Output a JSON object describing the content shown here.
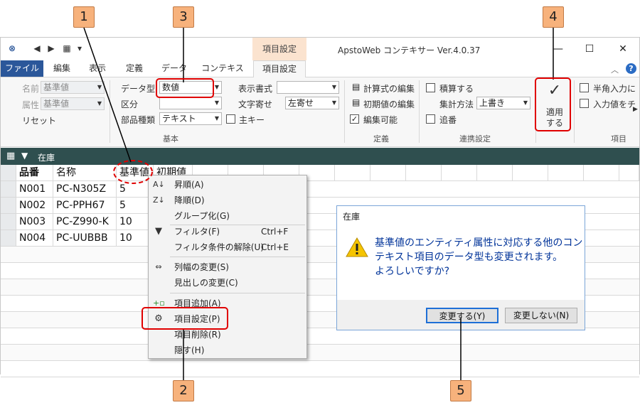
{
  "window": {
    "app_title": "ApstoWeb コンテキサー Ver.4.0.37",
    "context_tab_title": "項目設定",
    "tabs": [
      "ファイル",
      "編集",
      "表示",
      "定義",
      "データ",
      "コンテキスト",
      "項目設定"
    ]
  },
  "ribbon": {
    "name_label": "名前",
    "name_value": "基準値",
    "attr_label": "属性",
    "attr_value": "基準値",
    "reset_label": "リセット",
    "datatype_label": "データ型",
    "datatype_value": "数値",
    "kubun_label": "区分",
    "kubun_value": "",
    "parts_label": "部品種類",
    "parts_value": "テキスト",
    "mainkey_label": "主キー",
    "display_format_label": "表示書式",
    "display_format_value": "",
    "align_label": "文字寄せ",
    "align_value": "左寄せ",
    "group_kihon": "基本",
    "calc_edit_label": "計算式の編集",
    "init_edit_label": "初期値の編集",
    "editable_label": "編集可能",
    "group_teigi": "定義",
    "accumulate_label": "積算する",
    "agg_method_label": "集計方法",
    "agg_method_value": "上書き",
    "append_label": "追番",
    "group_renkei": "連携設定",
    "apply_label_1": "適用",
    "apply_label_2": "する",
    "hankaku_label": "半角入力に",
    "input_check_label": "入力値をチ",
    "group_item": "項目"
  },
  "grid": {
    "caption": "在庫",
    "headers": [
      "品番",
      "名称",
      "基準値",
      "初期値"
    ],
    "rows": [
      [
        "N001",
        "PC-N305Z",
        "5"
      ],
      [
        "N002",
        "PC-PPH67",
        "5"
      ],
      [
        "N003",
        "PC-Z990-K",
        "10"
      ],
      [
        "N004",
        "PC-UUBBB",
        "10"
      ]
    ]
  },
  "context_menu": {
    "items": [
      {
        "label": "昇順(A)",
        "shortcut": ""
      },
      {
        "label": "降順(D)",
        "shortcut": ""
      },
      {
        "label": "グループ化(G)",
        "shortcut": ""
      },
      {
        "label": "フィルタ(F)",
        "shortcut": "Ctrl+F"
      },
      {
        "label": "フィルタ条件の解除(U)",
        "shortcut": "Ctrl+E"
      },
      {
        "label": "列幅の変更(S)",
        "shortcut": ""
      },
      {
        "label": "見出しの変更(C)",
        "shortcut": ""
      },
      {
        "label": "項目追加(A)",
        "shortcut": ""
      },
      {
        "label": "項目設定(P)",
        "shortcut": ""
      },
      {
        "label": "項目削除(R)",
        "shortcut": ""
      },
      {
        "label": "隠す(H)",
        "shortcut": ""
      }
    ]
  },
  "dialog": {
    "title": "在庫",
    "message_line1": "基準値のエンティティ属性に対応する他のコン",
    "message_line2": "テキスト項目のデータ型も変更されます。",
    "message_line3": "よろしいですか?",
    "ok_label": "変更する(Y)",
    "cancel_label": "変更しない(N)"
  },
  "callouts": [
    "1",
    "2",
    "3",
    "4",
    "5"
  ],
  "colors": {
    "accent": "#2b579a",
    "grid_header": "#2f4f4f",
    "callout": "#f7b27c",
    "highlight": "#e00000"
  }
}
